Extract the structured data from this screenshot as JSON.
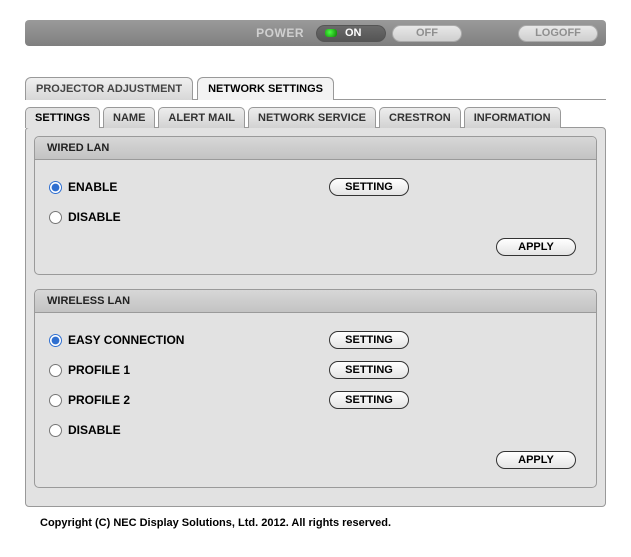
{
  "power_bar": {
    "power_label": "POWER",
    "on_label": "ON",
    "off_label": "OFF",
    "logoff_label": "LOGOFF"
  },
  "main_tabs": {
    "projector_adjustment": "PROJECTOR ADJUSTMENT",
    "network_settings": "NETWORK SETTINGS"
  },
  "sub_tabs": {
    "settings": "SETTINGS",
    "name": "NAME",
    "alert_mail": "ALERT MAIL",
    "network_service": "NETWORK SERVICE",
    "crestron": "CRESTRON",
    "information": "INFORMATION"
  },
  "wired": {
    "title": "WIRED LAN",
    "enable": "ENABLE",
    "disable": "DISABLE",
    "setting_btn": "SETTING",
    "apply_btn": "APPLY"
  },
  "wireless": {
    "title": "WIRELESS LAN",
    "easy": "EASY CONNECTION",
    "profile1": "PROFILE 1",
    "profile2": "PROFILE 2",
    "disable": "DISABLE",
    "setting_btn": "SETTING",
    "apply_btn": "APPLY"
  },
  "footer": "Copyright (C) NEC Display Solutions, Ltd. 2012. All rights reserved."
}
